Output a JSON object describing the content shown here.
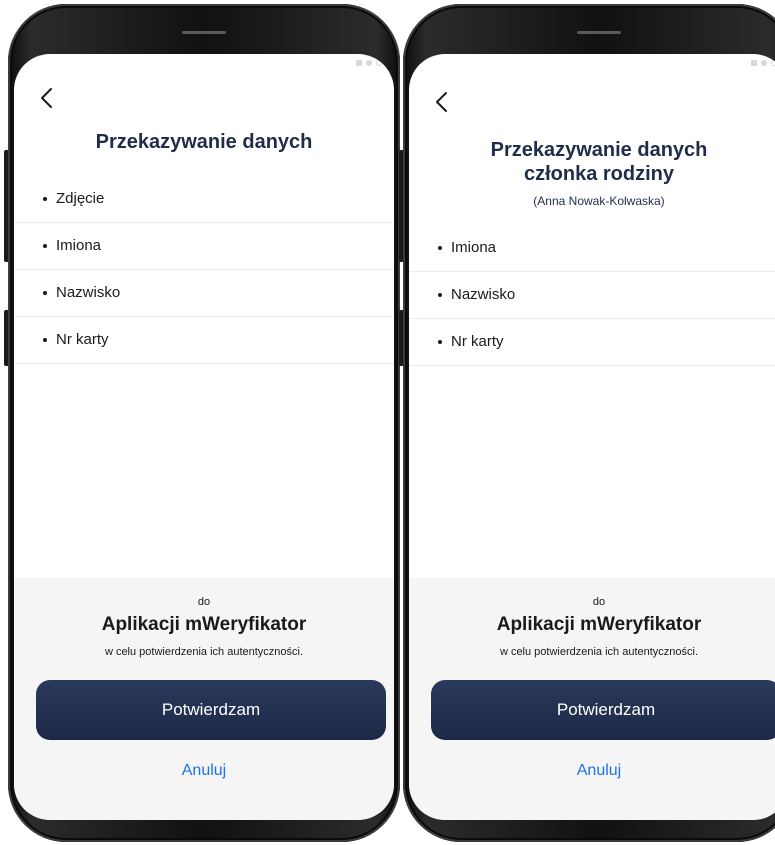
{
  "screens": [
    {
      "title": "Przekazywanie danych",
      "subtitle": "",
      "items": [
        "Zdjęcie",
        "Imiona",
        "Nazwisko",
        "Nr karty"
      ],
      "destination_prefix": "do",
      "app_name": "Aplikacji mWeryfikator",
      "purpose": "w celu potwierdzenia ich autentyczności.",
      "confirm_label": "Potwierdzam",
      "cancel_label": "Anuluj"
    },
    {
      "title_line1": "Przekazywanie danych",
      "title_line2": "członka rodziny",
      "subtitle": "(Anna Nowak-Kolwaska)",
      "items": [
        "Imiona",
        "Nazwisko",
        "Nr karty"
      ],
      "destination_prefix": "do",
      "app_name": "Aplikacji mWeryfikator",
      "purpose": "w celu potwierdzenia ich autentyczności.",
      "confirm_label": "Potwierdzam",
      "cancel_label": "Anuluj"
    }
  ],
  "colors": {
    "title": "#1f2c4a",
    "button": "#1c2846",
    "link": "#1a73e8"
  }
}
